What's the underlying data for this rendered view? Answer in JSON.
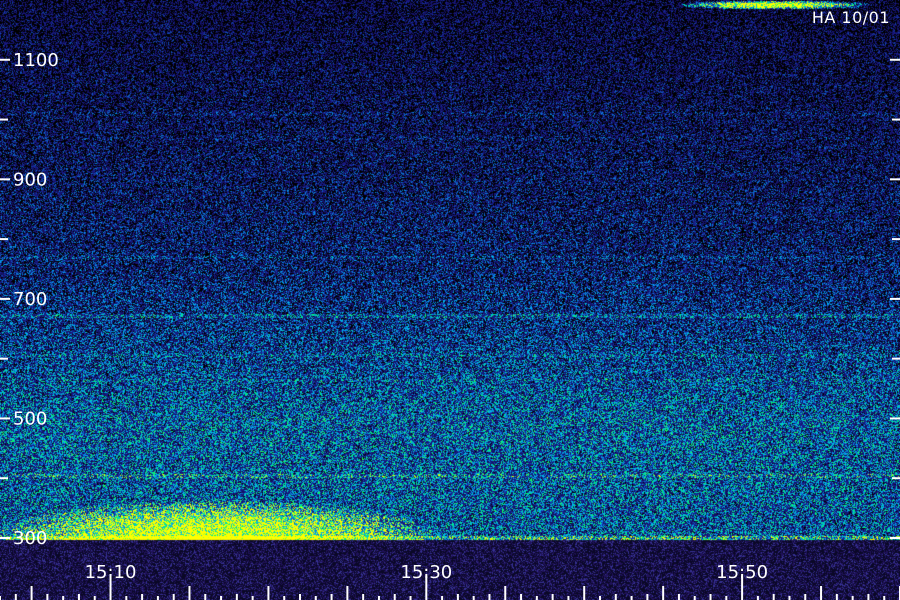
{
  "chart_data": {
    "type": "heatmap",
    "title": "",
    "station_label": "HA 10/01",
    "xlabel": "",
    "ylabel": "",
    "x_axis": {
      "type": "time",
      "range": [
        "15:03",
        "16:00"
      ],
      "labels": [
        "15:10",
        "15:30",
        "15:50"
      ]
    },
    "y_axis": {
      "type": "altitude",
      "range": [
        300,
        1200
      ],
      "labels": [
        300,
        500,
        700,
        900,
        1100
      ],
      "minor_ticks": [
        400,
        600,
        800,
        1000
      ]
    },
    "echo_regions": [
      {
        "time_range": [
          "15:03",
          "15:35"
        ],
        "altitude_range": [
          300,
          380
        ],
        "intensity": "high",
        "color": "#00ff66"
      },
      {
        "time_range": [
          "15:46",
          "15:58"
        ],
        "altitude_range": [
          1185,
          1200
        ],
        "intensity": "very high",
        "color": "#c8ff00"
      }
    ],
    "grid": false,
    "colors": {
      "background": "#000000",
      "low": "#1a1a8e",
      "medium": "#00b0ff",
      "high": "#00ff66",
      "peak": "#ffff00",
      "tick": "#ffffff"
    }
  }
}
